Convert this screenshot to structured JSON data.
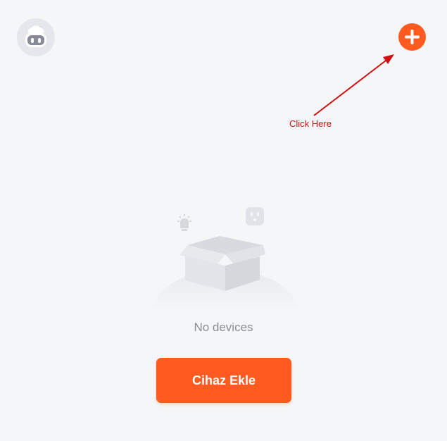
{
  "header": {
    "avatar_icon": "robot-avatar-icon",
    "add_icon": "plus-icon",
    "accent_color": "#ff5a1f"
  },
  "annotation": {
    "label": "Click Here",
    "color": "#d01010"
  },
  "empty_state": {
    "illustration_icons": [
      "bulb-icon",
      "socket-icon",
      "open-box-icon"
    ],
    "message": "No devices",
    "button_label": "Cihaz Ekle"
  }
}
